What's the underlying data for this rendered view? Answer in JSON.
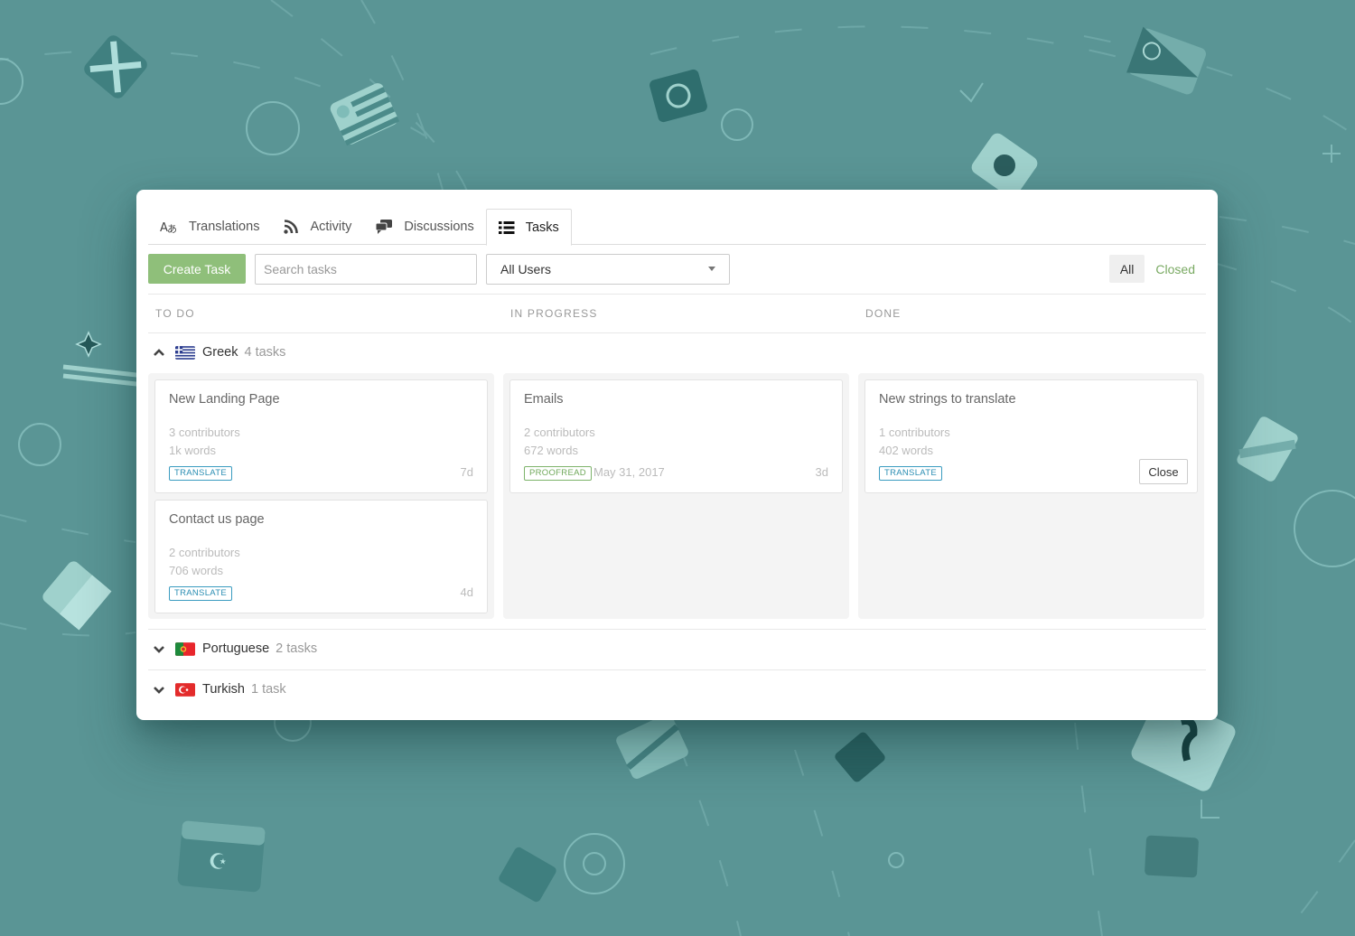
{
  "tabs": [
    {
      "label": "Translations",
      "icon": "translate-icon",
      "active": false
    },
    {
      "label": "Activity",
      "icon": "rss-icon",
      "active": false
    },
    {
      "label": "Discussions",
      "icon": "comments-icon",
      "active": false
    },
    {
      "label": "Tasks",
      "icon": "list-icon",
      "active": true
    }
  ],
  "toolbar": {
    "create_label": "Create Task",
    "search_placeholder": "Search tasks",
    "search_value": "",
    "user_filter": "All Users",
    "filters": {
      "all": "All",
      "closed": "Closed",
      "selected": "All"
    }
  },
  "columns": [
    "TO DO",
    "IN PROGRESS",
    "DONE"
  ],
  "groups": [
    {
      "language": "Greek",
      "count_label": "4 tasks",
      "expanded": true,
      "flag": "greece",
      "todo": [
        {
          "title": "New Landing Page",
          "contributors": "3 contributors",
          "words": "1k words",
          "badge": "TRANSLATE",
          "age": "7d"
        },
        {
          "title": "Contact us page",
          "contributors": "2 contributors",
          "words": "706 words",
          "badge": "TRANSLATE",
          "age": "4d"
        }
      ],
      "in_progress": [
        {
          "title": "Emails",
          "contributors": "2 contributors",
          "words": "672 words",
          "badge": "PROOFREAD",
          "date": "May 31, 2017",
          "age": "3d"
        }
      ],
      "done": [
        {
          "title": "New strings to translate",
          "contributors": "1 contributors",
          "words": "402 words",
          "badge": "TRANSLATE",
          "action": "Close"
        }
      ]
    },
    {
      "language": "Portuguese",
      "count_label": "2 tasks",
      "expanded": false,
      "flag": "portugal"
    },
    {
      "language": "Turkish",
      "count_label": "1 task",
      "expanded": false,
      "flag": "turkey"
    }
  ],
  "colors": {
    "background": "#5a9595",
    "accent_green": "#8fbf7a",
    "translate_badge": "#2b8eb3",
    "proofread_badge": "#6fa85a"
  }
}
